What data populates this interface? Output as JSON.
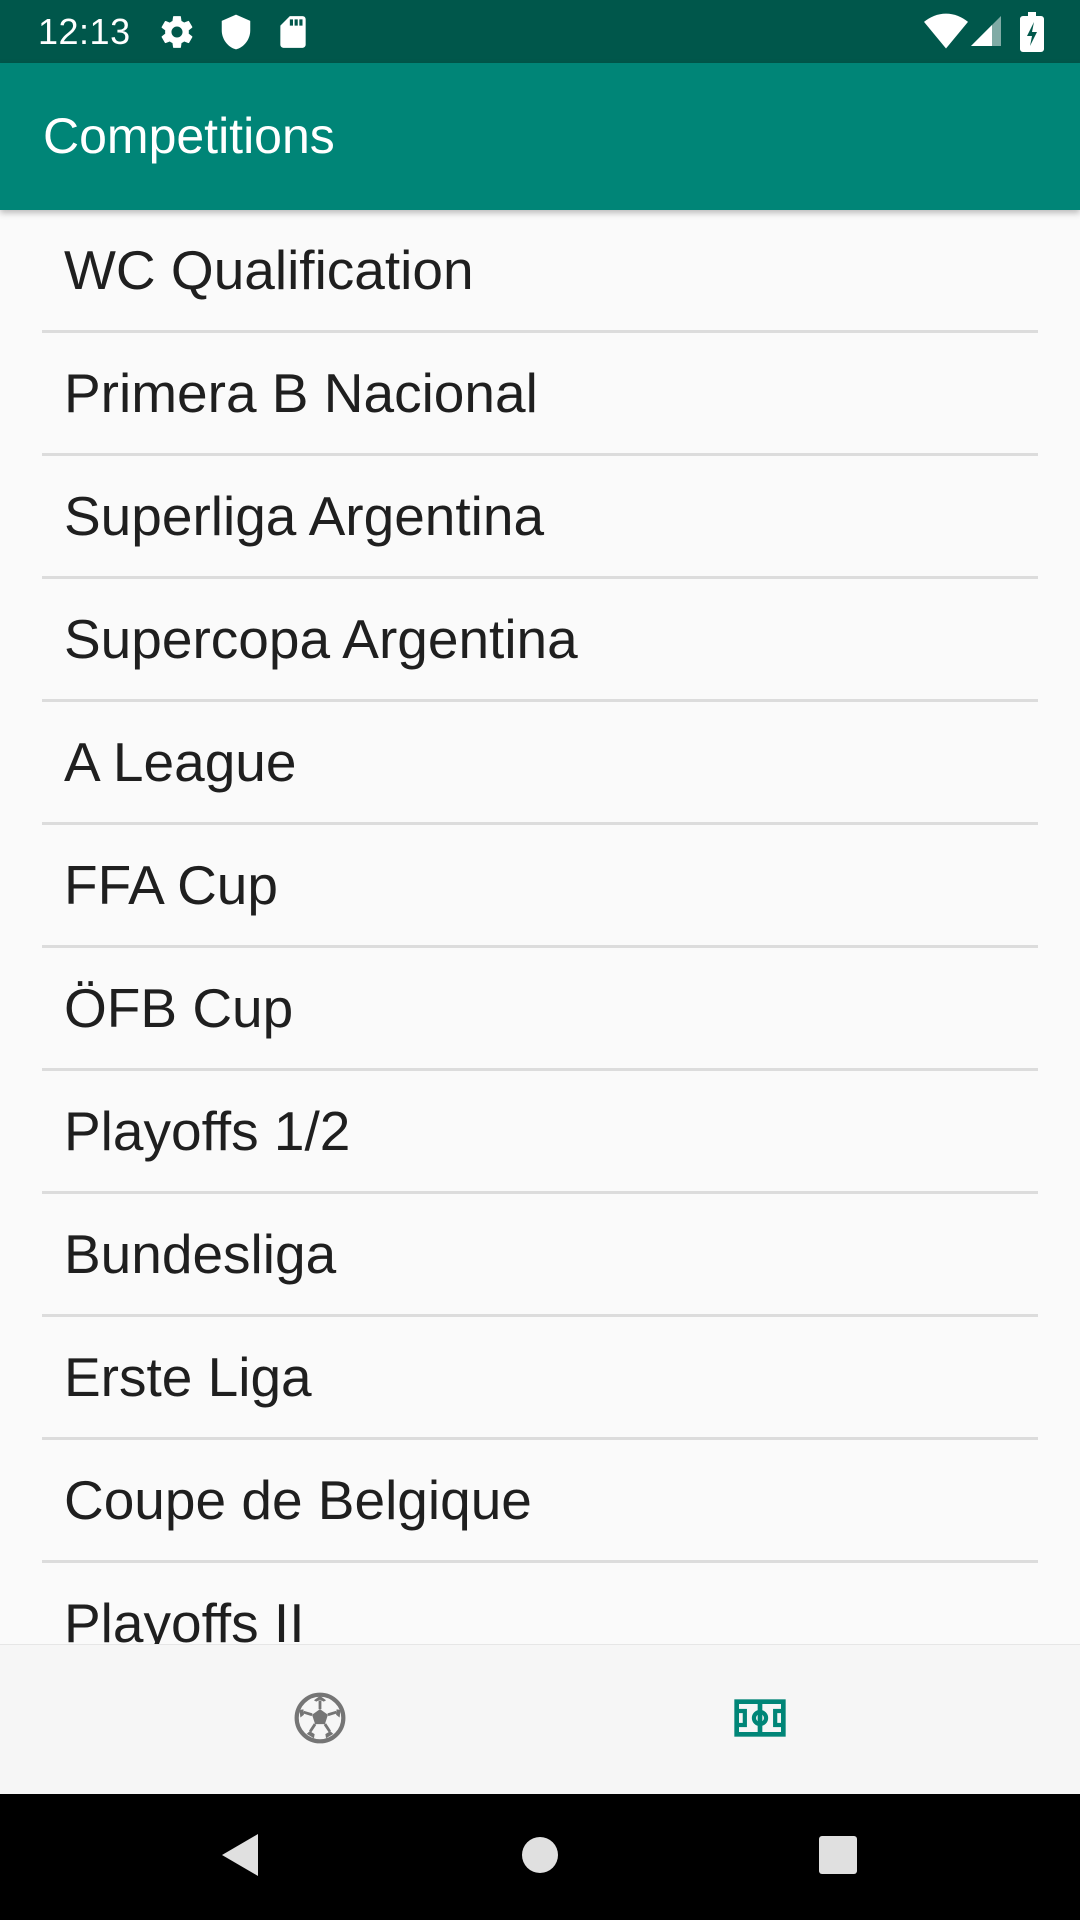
{
  "status_bar": {
    "time": "12:13",
    "icons": [
      "gear-icon",
      "shield-icon",
      "sd-card-icon",
      "wifi-icon",
      "signal-icon",
      "battery-charging-icon"
    ]
  },
  "app_bar": {
    "title": "Competitions"
  },
  "competitions": [
    "WC Qualification",
    "Primera B Nacional",
    "Superliga Argentina",
    "Supercopa Argentina",
    "A League",
    "FFA Cup",
    "ÖFB Cup",
    "Playoffs 1/2",
    "Bundesliga",
    "Erste Liga",
    "Coupe de Belgique",
    "Playoffs II"
  ],
  "bottom_nav": {
    "tabs": [
      {
        "icon": "soccer-ball-icon",
        "selected": false
      },
      {
        "icon": "soccer-field-icon",
        "selected": true
      }
    ]
  },
  "system_nav": {
    "buttons": [
      "back-icon",
      "home-icon",
      "recents-icon"
    ]
  },
  "colors": {
    "primary": "#008577",
    "primary_dark": "#00574b",
    "inactive_icon": "#757575",
    "list_text": "#1f1f1f",
    "divider": "#dcdcdc",
    "background": "#fafafa"
  }
}
